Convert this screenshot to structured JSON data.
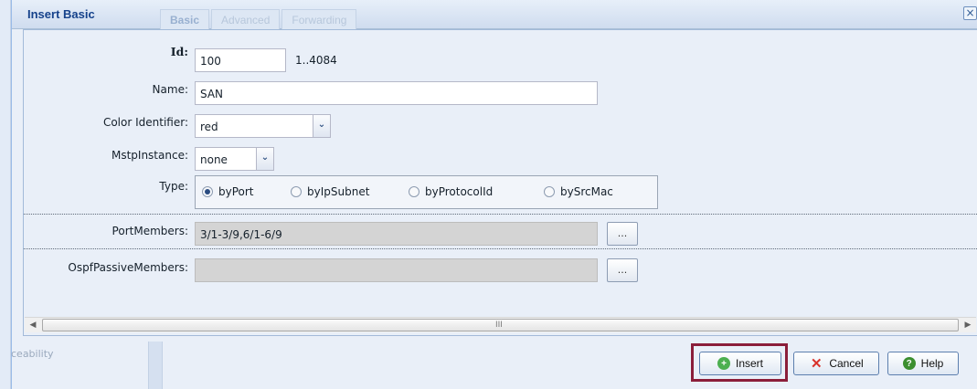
{
  "dialog": {
    "title": "Insert Basic",
    "tabs": [
      {
        "label": "Basic",
        "active": true
      },
      {
        "label": "Advanced",
        "active": false
      },
      {
        "label": "Forwarding",
        "active": false
      }
    ],
    "close_label": "×"
  },
  "form": {
    "id": {
      "label": "Id:",
      "value": "100",
      "range_hint": "1..4084"
    },
    "name": {
      "label": "Name:",
      "value": "SAN"
    },
    "color": {
      "label": "Color Identifier:",
      "value": "red"
    },
    "mstp": {
      "label": "MstpInstance:",
      "value": "none"
    },
    "type": {
      "label": "Type:",
      "options": [
        {
          "label": "byPort",
          "checked": true
        },
        {
          "label": "byIpSubnet",
          "checked": false
        },
        {
          "label": "byProtocolId",
          "checked": false
        },
        {
          "label": "bySrcMac",
          "checked": false
        }
      ]
    },
    "port_members": {
      "label": "PortMembers:",
      "value": "3/1-3/9,6/1-6/9",
      "button": "..."
    },
    "ospf_passive_members": {
      "label": "OspfPassiveMembers:",
      "value": "",
      "button": "..."
    }
  },
  "scrollbar": {
    "left_arrow": "◀",
    "right_arrow": "▶",
    "grip": "III"
  },
  "buttons": {
    "insert": "Insert",
    "cancel": "Cancel",
    "help": "Help"
  },
  "background": {
    "footer_text": "ceability"
  },
  "colors": {
    "highlight": "#8b1e3a",
    "title": "#15428b",
    "insert_icon": "#4caf50",
    "cancel_icon": "#d9322b"
  }
}
